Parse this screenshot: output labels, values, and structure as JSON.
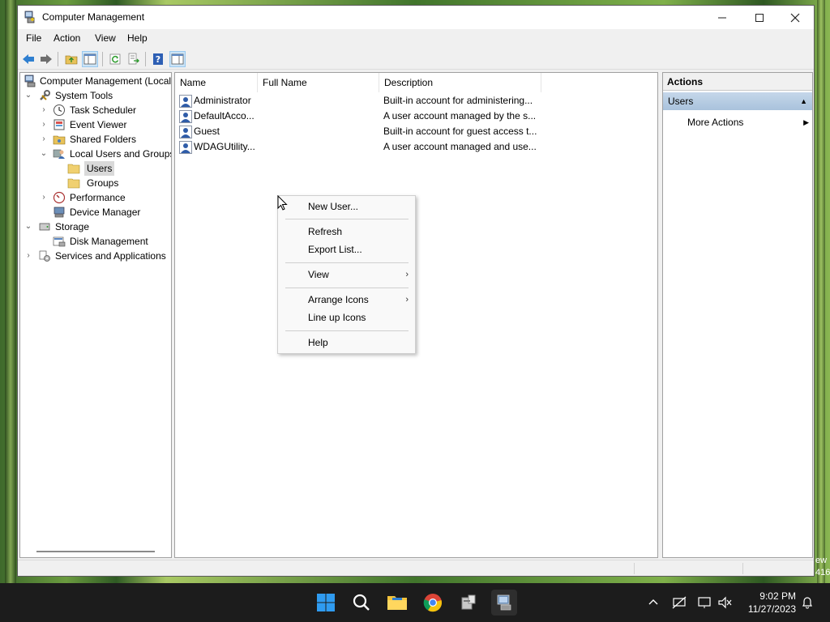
{
  "window": {
    "title": "Computer Management",
    "menu": [
      "File",
      "Action",
      "View",
      "Help"
    ]
  },
  "tree": {
    "root": "Computer Management (Local",
    "system_tools": "System Tools",
    "task_scheduler": "Task Scheduler",
    "event_viewer": "Event Viewer",
    "shared_folders": "Shared Folders",
    "local_users": "Local Users and Groups",
    "users": "Users",
    "groups": "Groups",
    "performance": "Performance",
    "device_manager": "Device Manager",
    "storage": "Storage",
    "disk_management": "Disk Management",
    "services": "Services and Applications"
  },
  "list": {
    "columns": [
      "Name",
      "Full Name",
      "Description"
    ],
    "rows": [
      {
        "name": "Administrator",
        "full_name": "",
        "description": "Built-in account for administering..."
      },
      {
        "name": "DefaultAcco...",
        "full_name": "",
        "description": "A user account managed by the s..."
      },
      {
        "name": "Guest",
        "full_name": "",
        "description": "Built-in account for guest access t..."
      },
      {
        "name": "WDAGUtility...",
        "full_name": "",
        "description": "A user account managed and use..."
      }
    ]
  },
  "actions": {
    "title": "Actions",
    "group": "Users",
    "more": "More Actions"
  },
  "context_menu": {
    "new_user": "New User...",
    "refresh": "Refresh",
    "export": "Export List...",
    "view": "View",
    "arrange": "Arrange Icons",
    "lineup": "Line up Icons",
    "help": "Help"
  },
  "taskbar": {
    "time": "9:02 PM",
    "date": "11/27/2023",
    "behind_text_1": "ew",
    "behind_text_2": "416"
  },
  "colors": {
    "selection": "#cce4f7",
    "actions_header": "#b7cce3",
    "taskbar": "#1c1c1c"
  }
}
